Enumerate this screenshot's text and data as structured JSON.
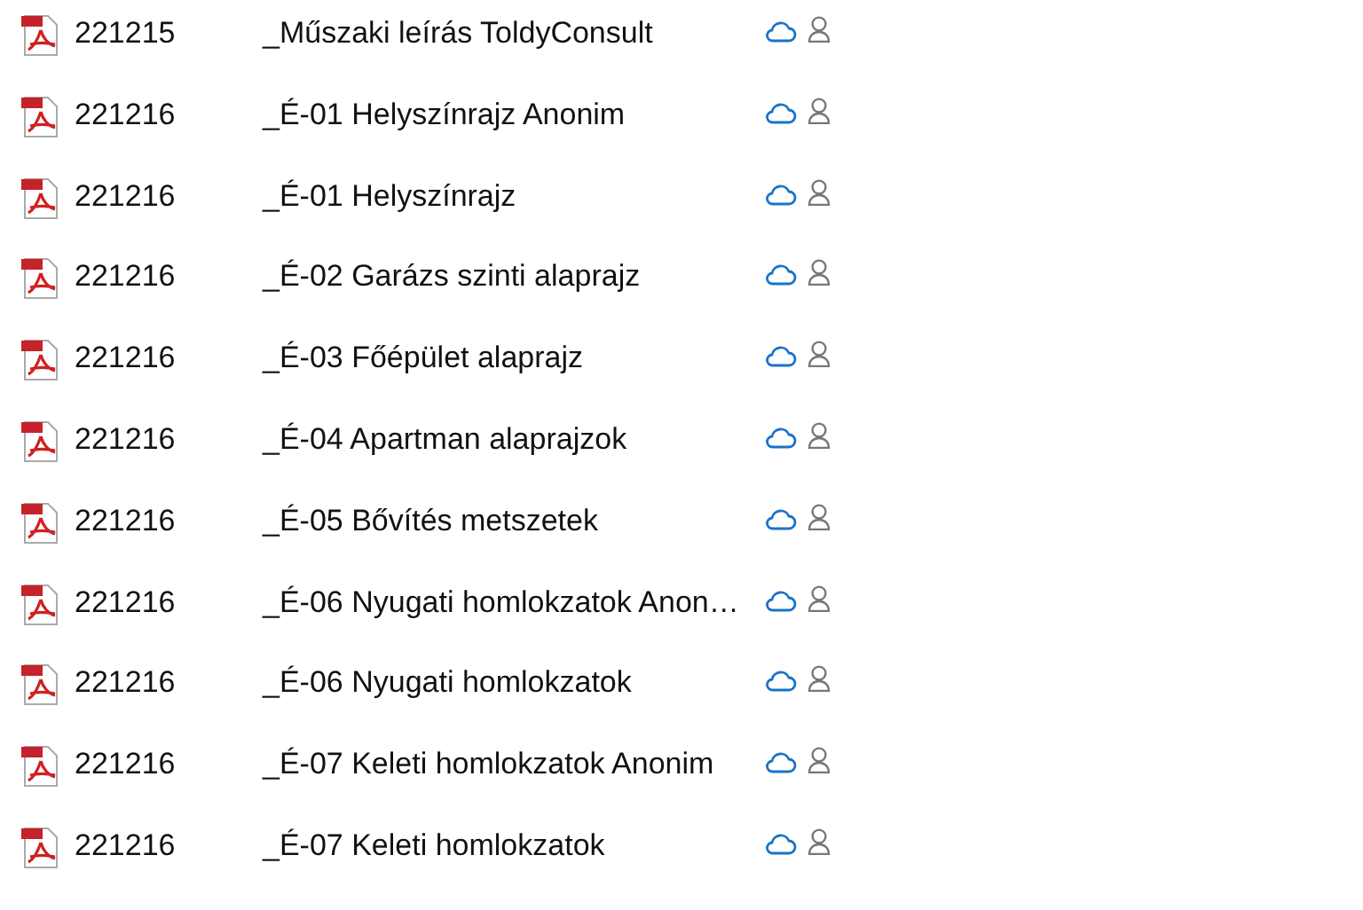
{
  "files": [
    {
      "date": "221215",
      "name": "_Műszaki leírás ToldyConsult"
    },
    {
      "date": "221216",
      "name": "_É-01 Helyszínrajz Anonim"
    },
    {
      "date": "221216",
      "name": "_É-01 Helyszínrajz"
    },
    {
      "date": "221216",
      "name": "_É-02 Garázs szinti alaprajz"
    },
    {
      "date": "221216",
      "name": "_É-03 Főépület alaprajz"
    },
    {
      "date": "221216",
      "name": "_É-04 Apartman alaprajzok"
    },
    {
      "date": "221216",
      "name": "_É-05 Bővítés metszetek"
    },
    {
      "date": "221216",
      "name": "_É-06 Nyugati homlokzatok Anon…"
    },
    {
      "date": "221216",
      "name": "_É-06 Nyugati homlokzatok"
    },
    {
      "date": "221216",
      "name": "_É-07 Keleti homlokzatok Anonim"
    },
    {
      "date": "221216",
      "name": "_É-07 Keleti homlokzatok"
    }
  ]
}
